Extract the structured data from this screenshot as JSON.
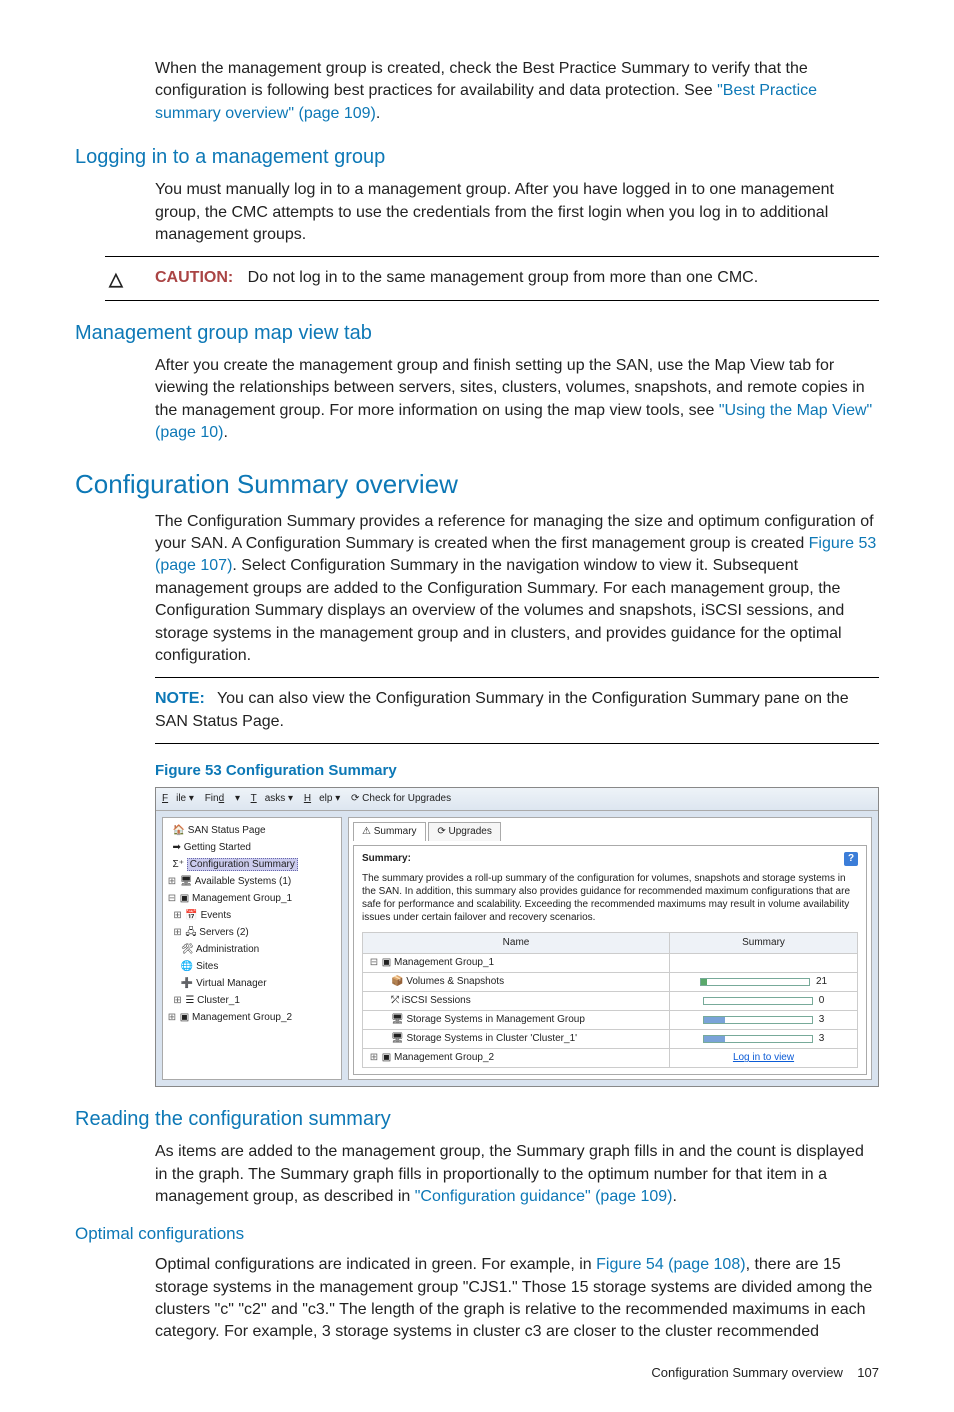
{
  "intro": {
    "p1a": "When the management group is created, check the Best Practice Summary to verify that the configuration is following best practices for availability and data protection. See ",
    "link1": "\"Best Practice summary overview\" (page 109)",
    "p1b": "."
  },
  "sec_login": {
    "heading": "Logging in to a management group",
    "p1": "You must manually log in to a management group. After you have logged in to one management group, the CMC attempts to use the credentials from the first login when you log in to additional management groups."
  },
  "caution": {
    "label": "CAUTION:",
    "text": "Do not log in to the same management group from more than one CMC."
  },
  "sec_mapview": {
    "heading": "Management group map view tab",
    "p1a": "After you create the management group and finish setting up the SAN, use the Map View tab for viewing the relationships between servers, sites, clusters, volumes, snapshots, and remote copies in the management group. For more information on using the map view tools, see ",
    "link1": "\"Using the Map View\" (page 10)",
    "p1b": "."
  },
  "sec_config": {
    "heading": "Configuration Summary overview",
    "p1a": "The Configuration Summary provides a reference for managing the size and optimum configuration of your SAN. A Configuration Summary is created when the first management group is created ",
    "link1": "Figure 53 (page 107)",
    "p1b": ". Select Configuration Summary in the navigation window to view it. Subsequent management groups are added to the Configuration Summary. For each management group, the Configuration Summary displays an overview of the volumes and snapshots, iSCSI sessions, and storage systems in the management group and in clusters, and provides guidance for the optimal configuration."
  },
  "note": {
    "label": "NOTE:",
    "text": "You can also view the Configuration Summary in the Configuration Summary pane on the SAN Status Page."
  },
  "figure": {
    "caption": "Figure 53 Configuration Summary"
  },
  "screenshot": {
    "menu": {
      "file": "File ▾",
      "find": "Find ▾",
      "tasks": "Tasks ▾",
      "help": "Help ▾",
      "check": "⟳ Check for Upgrades"
    },
    "tree": {
      "r0": "SAN Status Page",
      "r1": "Getting Started",
      "r2": "Configuration Summary",
      "r3": "Available Systems (1)",
      "r4": "Management Group_1",
      "r5": "Events",
      "r6": "Servers (2)",
      "r7": "Administration",
      "r8": "Sites",
      "r9": "Virtual Manager",
      "r10": "Cluster_1",
      "r11": "Management Group_2"
    },
    "tabs": {
      "summary": "⚠ Summary",
      "upgrades": "⟳ Upgrades"
    },
    "panel": {
      "summary_label": "Summary:",
      "help": "?",
      "desc": "The summary provides a roll-up summary of the configuration for volumes, snapshots and storage systems in the SAN. In addition, this summary also provides guidance for recommended maximum configurations that are safe for performance and scalability. Exceeding the recommended maximums may result in volume availability issues under certain failover and recovery scenarios.",
      "th_name": "Name",
      "th_summary": "Summary",
      "row0": "Management Group_1",
      "row1": "Volumes & Snapshots",
      "row1v": "21",
      "row2": "iSCSI Sessions",
      "row2v": "0",
      "row3": "Storage Systems in Management Group",
      "row3v": "3",
      "row4": "Storage Systems in Cluster 'Cluster_1'",
      "row4v": "3",
      "row5": "Management Group_2",
      "row5v": "Log in to view"
    }
  },
  "sec_reading": {
    "heading": "Reading the configuration summary",
    "p1a": "As items are added to the management group, the Summary graph fills in and the count is displayed in the graph. The Summary graph fills in proportionally to the optimum number for that item in a management group, as described in ",
    "link1": "\"Configuration guidance\" (page 109)",
    "p1b": "."
  },
  "sec_optimal": {
    "heading": "Optimal configurations",
    "p1a": "Optimal configurations are indicated in green. For example, in ",
    "link1": "Figure 54 (page 108)",
    "p1b": ", there are 15 storage systems in the management group \"CJS1.\" Those 15 storage systems are divided among the clusters \"c\" \"c2\" and \"c3.\" The length of the graph is relative to the recommended maximums in each category. For example, 3 storage systems in cluster c3 are closer to the cluster recommended"
  },
  "footer": {
    "text": "Configuration Summary overview",
    "page": "107"
  }
}
